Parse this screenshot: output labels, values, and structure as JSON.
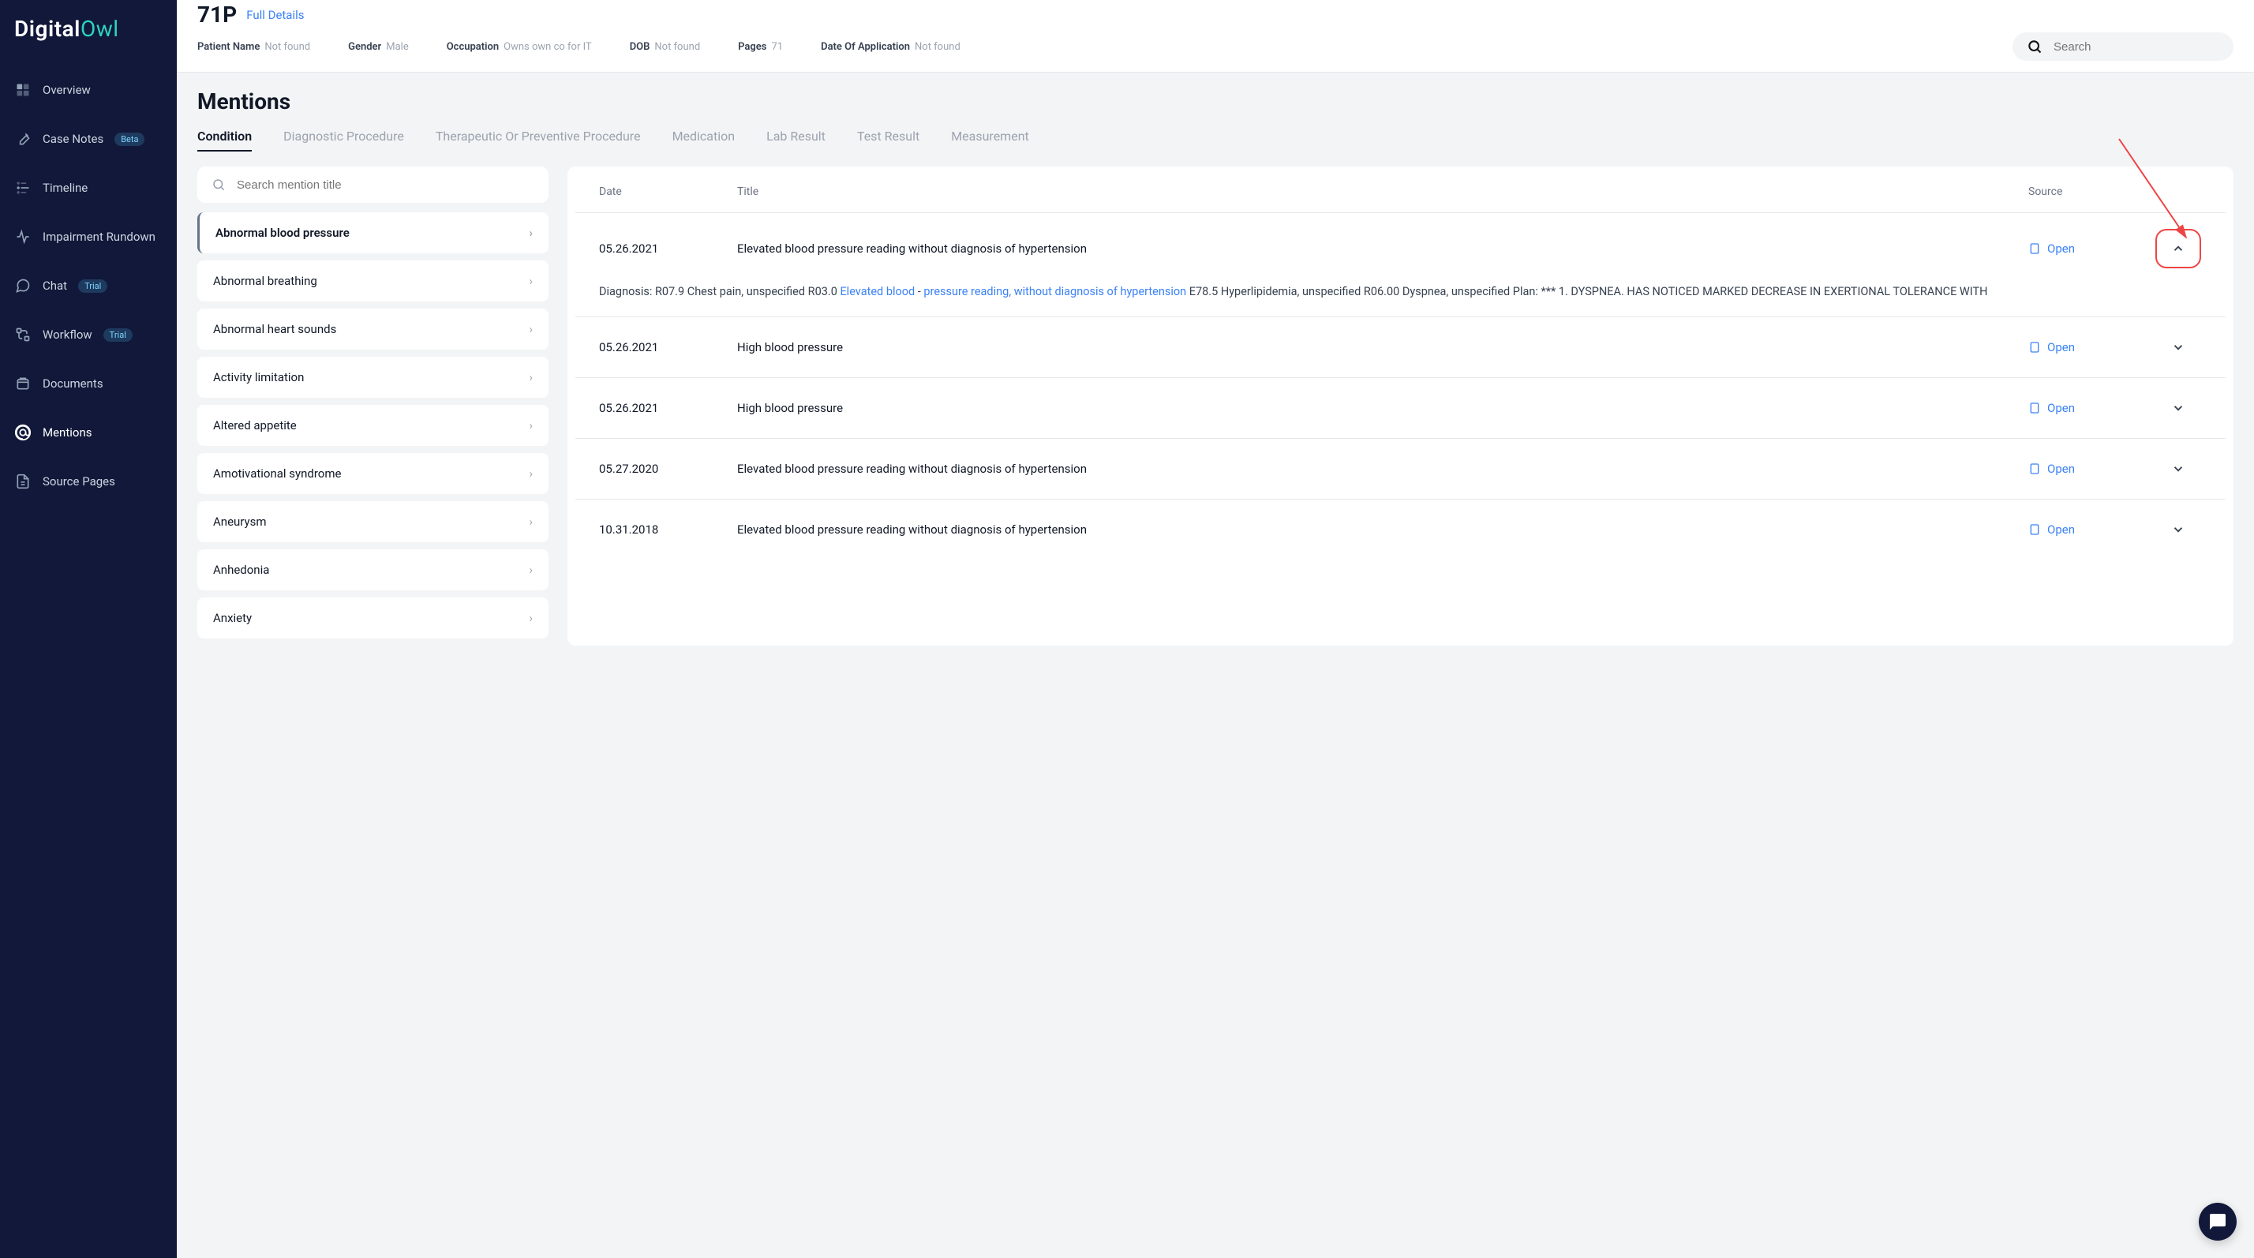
{
  "logo": {
    "part1": "Digital",
    "part2": "Owl"
  },
  "sidebar": {
    "items": [
      {
        "label": "Overview",
        "badge": null
      },
      {
        "label": "Case Notes",
        "badge": "Beta"
      },
      {
        "label": "Timeline",
        "badge": null
      },
      {
        "label": "Impairment Rundown",
        "badge": null
      },
      {
        "label": "Chat",
        "badge": "Trial"
      },
      {
        "label": "Workflow",
        "badge": "Trial"
      },
      {
        "label": "Documents",
        "badge": null
      },
      {
        "label": "Mentions",
        "badge": null
      },
      {
        "label": "Source Pages",
        "badge": null
      }
    ]
  },
  "header": {
    "case_id": "71P",
    "full_details": "Full Details",
    "meta": [
      {
        "label": "Patient Name",
        "value": "Not found"
      },
      {
        "label": "Gender",
        "value": "Male"
      },
      {
        "label": "Occupation",
        "value": "Owns own co for IT"
      },
      {
        "label": "DOB",
        "value": "Not found"
      },
      {
        "label": "Pages",
        "value": "71"
      },
      {
        "label": "Date Of Application",
        "value": "Not found"
      }
    ],
    "search_placeholder": "Search"
  },
  "page": {
    "title": "Mentions",
    "tabs": [
      "Condition",
      "Diagnostic Procedure",
      "Therapeutic Or Preventive Procedure",
      "Medication",
      "Lab Result",
      "Test Result",
      "Measurement"
    ],
    "mention_search_placeholder": "Search mention title",
    "mentions": [
      "Abnormal blood pressure",
      "Abnormal breathing",
      "Abnormal heart sounds",
      "Activity limitation",
      "Altered appetite",
      "Amotivational syndrome",
      "Aneurysm",
      "Anhedonia",
      "Anxiety"
    ],
    "table_head": {
      "date": "Date",
      "title": "Title",
      "source": "Source"
    },
    "open_label": "Open",
    "entries": [
      {
        "date": "05.26.2021",
        "title": "Elevated blood pressure reading without diagnosis of hypertension",
        "expanded": true,
        "detail_pre": "Diagnosis: R07.9 Chest pain, unspecified R03.0 ",
        "detail_link1": "Elevated blood",
        "detail_mid": " - ",
        "detail_link2": "pressure reading, without diagnosis of hypertension",
        "detail_post": " E78.5 Hyperlipidemia, unspecified R06.00 Dyspnea, unspecified Plan: *** 1. DYSPNEA. HAS NOTICED MARKED DECREASE IN EXERTIONAL TOLERANCE WITH"
      },
      {
        "date": "05.26.2021",
        "title": "High blood pressure",
        "expanded": false
      },
      {
        "date": "05.26.2021",
        "title": "High blood pressure",
        "expanded": false
      },
      {
        "date": "05.27.2020",
        "title": "Elevated blood pressure reading without diagnosis of hypertension",
        "expanded": false
      },
      {
        "date": "10.31.2018",
        "title": "Elevated blood pressure reading without diagnosis of hypertension",
        "expanded": false
      }
    ]
  }
}
